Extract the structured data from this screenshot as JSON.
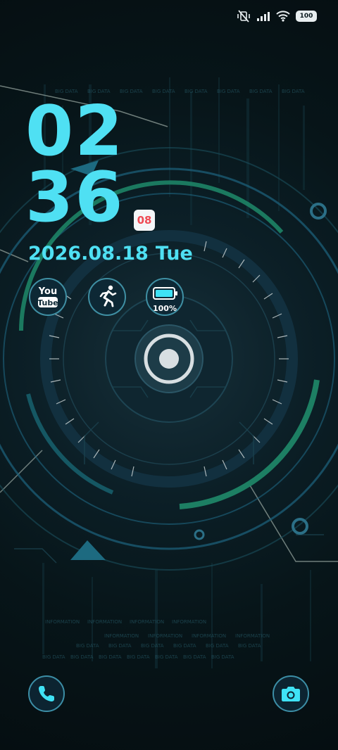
{
  "status_bar": {
    "icons": [
      "vibrate-off-icon",
      "signal-icon",
      "wifi-icon",
      "battery-icon"
    ],
    "battery_level": "100"
  },
  "lockscreen": {
    "hour": "02",
    "minute": "36",
    "seconds": "08",
    "date": "2026.08.18",
    "weekday": "Tue"
  },
  "widgets": {
    "youtube_icon": "youtube-icon",
    "steps_icon": "running-person-icon",
    "battery_percent": "100%"
  },
  "shortcuts": {
    "phone_icon": "phone-icon",
    "camera_icon": "camera-icon"
  },
  "wallpaper": {
    "texts": [
      "BIG DATA",
      "INFORMATION"
    ]
  },
  "colors": {
    "accent": "#4fe0f3",
    "badge_text": "#ef4b55",
    "ring_green": "#1f8a6a",
    "ring_blue": "#1c5f78"
  }
}
